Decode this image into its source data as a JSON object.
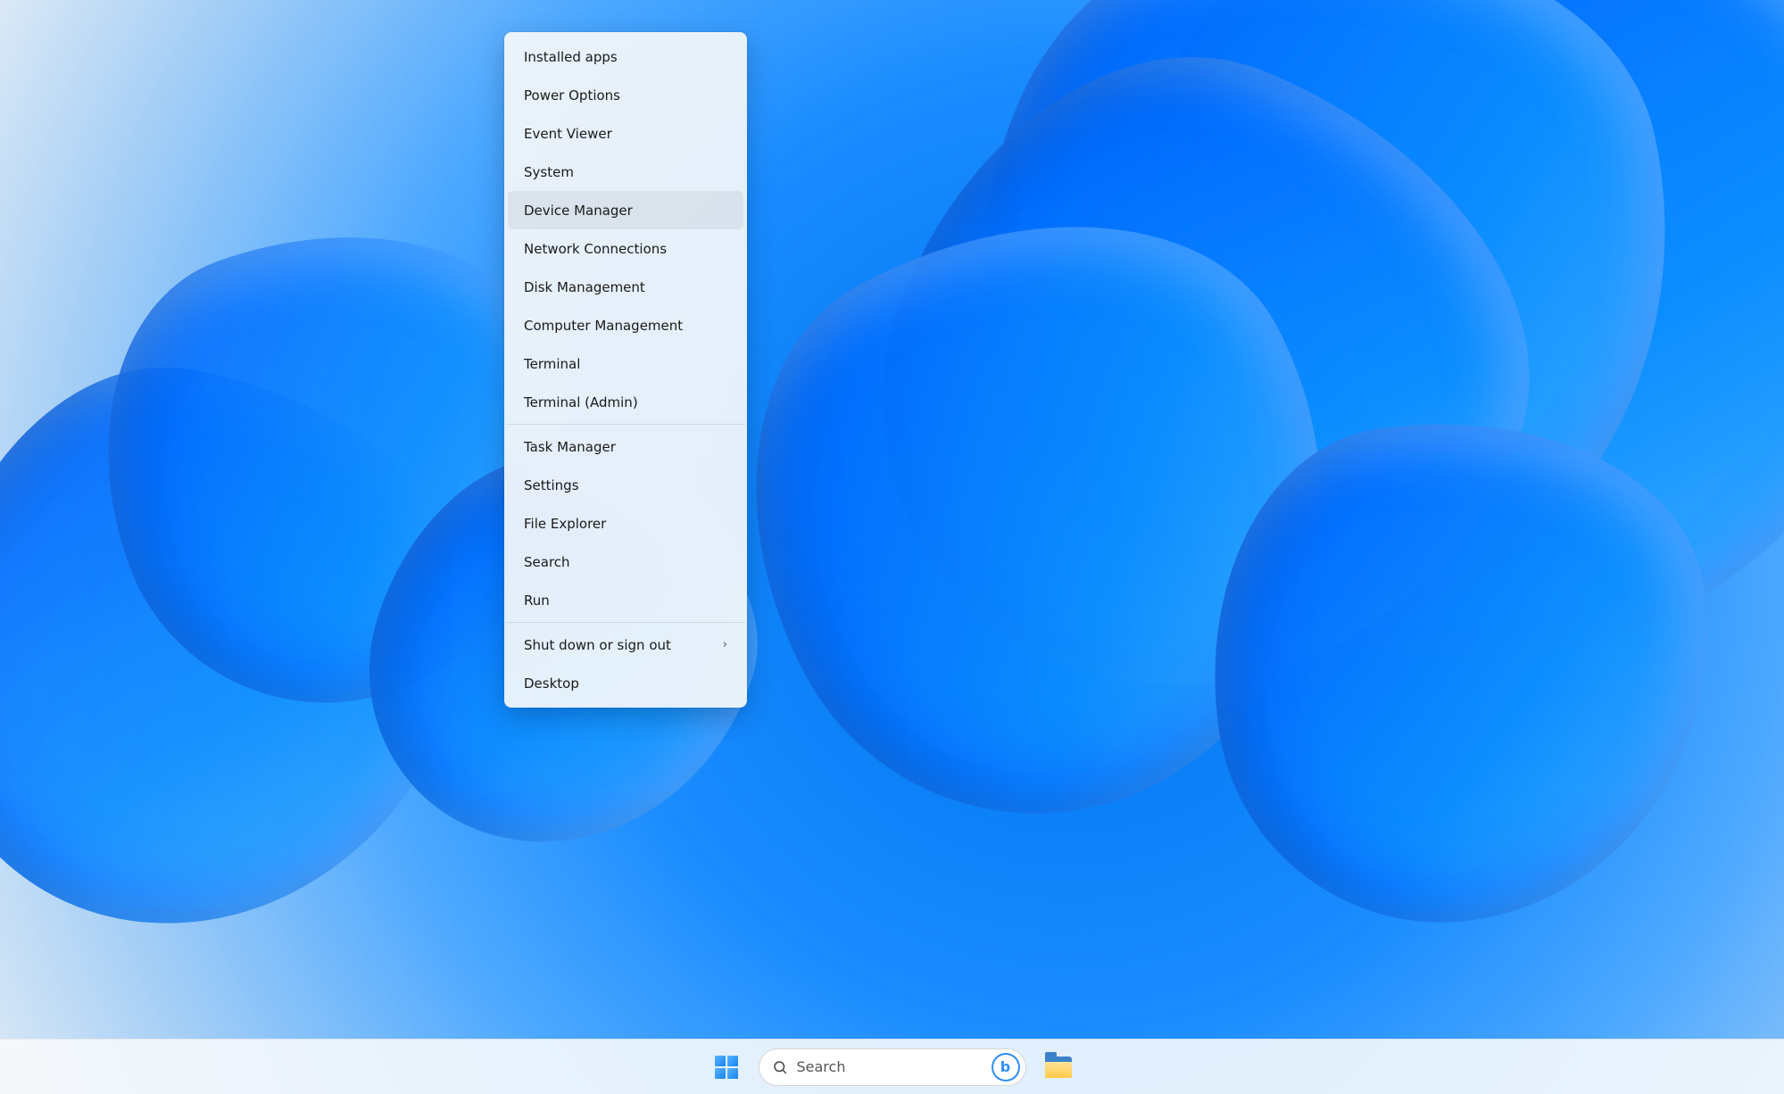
{
  "context_menu": {
    "highlighted_index": 4,
    "groups": [
      [
        {
          "label": "Installed apps",
          "submenu": false
        },
        {
          "label": "Power Options",
          "submenu": false
        },
        {
          "label": "Event Viewer",
          "submenu": false
        },
        {
          "label": "System",
          "submenu": false
        },
        {
          "label": "Device Manager",
          "submenu": false
        },
        {
          "label": "Network Connections",
          "submenu": false
        },
        {
          "label": "Disk Management",
          "submenu": false
        },
        {
          "label": "Computer Management",
          "submenu": false
        },
        {
          "label": "Terminal",
          "submenu": false
        },
        {
          "label": "Terminal (Admin)",
          "submenu": false
        }
      ],
      [
        {
          "label": "Task Manager",
          "submenu": false
        },
        {
          "label": "Settings",
          "submenu": false
        },
        {
          "label": "File Explorer",
          "submenu": false
        },
        {
          "label": "Search",
          "submenu": false
        },
        {
          "label": "Run",
          "submenu": false
        }
      ],
      [
        {
          "label": "Shut down or sign out",
          "submenu": true
        },
        {
          "label": "Desktop",
          "submenu": false
        }
      ]
    ]
  },
  "taskbar": {
    "search_label": "Search"
  }
}
